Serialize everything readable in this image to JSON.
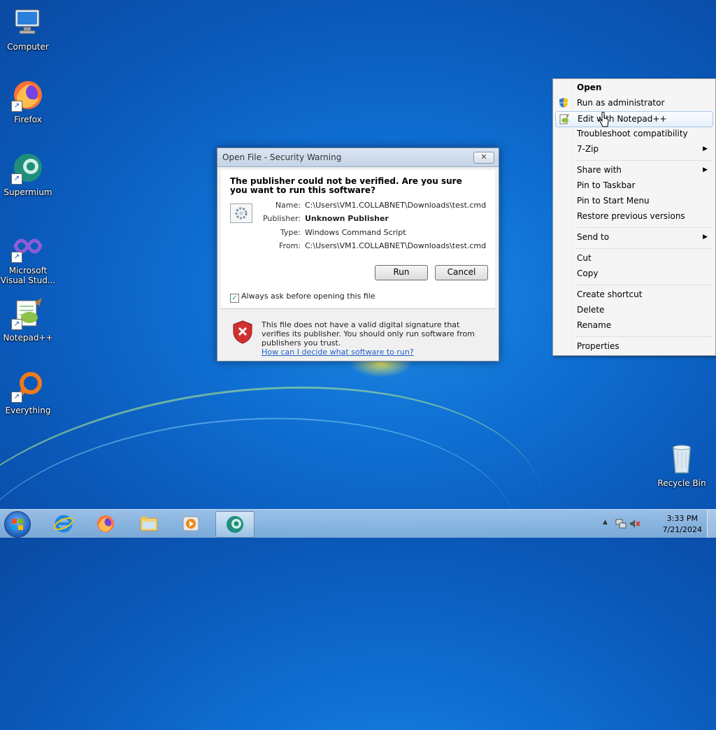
{
  "desktop": {
    "icons": [
      {
        "label": "Computer"
      },
      {
        "label": "Firefox"
      },
      {
        "label": "Supermium"
      },
      {
        "label": "Microsoft Visual Stud..."
      },
      {
        "label": "Notepad++"
      },
      {
        "label": "Everything"
      },
      {
        "label": "Recycle Bin"
      }
    ]
  },
  "dialog": {
    "title": "Open File - Security Warning",
    "close_label": "✕",
    "question": "The publisher could not be verified.  Are you sure you want to run this software?",
    "fields": [
      {
        "key": "Name:",
        "value": "C:\\Users\\VM1.COLLABNET\\Downloads\\test.cmd"
      },
      {
        "key": "Publisher:",
        "value": "Unknown Publisher"
      },
      {
        "key": "Type:",
        "value": "Windows Command Script"
      },
      {
        "key": "From:",
        "value": "C:\\Users\\VM1.COLLABNET\\Downloads\\test.cmd"
      }
    ],
    "run_label": "Run",
    "cancel_label": "Cancel",
    "checkbox_label": "Always ask before opening this file",
    "checkbox_checked": true,
    "warning_text": "This file does not have a valid digital signature that verifies its publisher.  You should only run software from publishers you trust.",
    "warning_link": "How can I decide what software to run?"
  },
  "context_menu": {
    "items": [
      {
        "label": "Open",
        "bold": true
      },
      {
        "label": "Run as administrator",
        "icon": "uac-shield-icon"
      },
      {
        "label": "Edit with Notepad++",
        "icon": "notepadpp-icon",
        "hover": true
      },
      {
        "label": "Troubleshoot compatibility"
      },
      {
        "label": "7-Zip",
        "submenu": true
      },
      {
        "label": "Share with",
        "submenu": true
      },
      {
        "label": "Pin to Taskbar"
      },
      {
        "label": "Pin to Start Menu"
      },
      {
        "label": "Restore previous versions"
      },
      {
        "label": "Send to",
        "submenu": true
      },
      {
        "label": "Cut"
      },
      {
        "label": "Copy"
      },
      {
        "label": "Create shortcut"
      },
      {
        "label": "Delete"
      },
      {
        "label": "Rename"
      },
      {
        "label": "Properties"
      }
    ],
    "submenu_arrow": "▶"
  },
  "taskbar": {
    "apps": [
      "internet-explorer-icon",
      "firefox-icon",
      "file-explorer-icon",
      "media-player-icon",
      "supermium-icon"
    ],
    "active_app": "supermium-icon",
    "time": "3:33 PM",
    "date": "7/21/2024"
  }
}
